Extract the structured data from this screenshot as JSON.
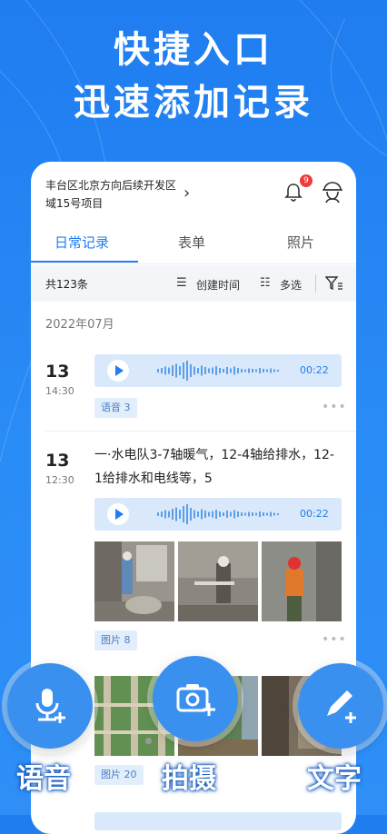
{
  "headline": {
    "line1": "快捷入口",
    "line2": "迅速添加记录"
  },
  "header": {
    "project_name": "丰台区北京方向后续开发区域15号项目",
    "notification_count": "9"
  },
  "tabs": [
    {
      "label": "日常记录",
      "active": true
    },
    {
      "label": "表单"
    },
    {
      "label": "照片"
    }
  ],
  "toolbar": {
    "count": "共123条",
    "sort_label": "创建时间",
    "multi_label": "多选"
  },
  "month": "2022年07月",
  "records": [
    {
      "day": "13",
      "time": "14:30",
      "audio_duration": "00:22",
      "tag": "语音 3"
    },
    {
      "day": "13",
      "time": "12:30",
      "text": "一·水电队3-7轴暖气，12-4轴给排水，12-1给排水和电线等，5",
      "audio_duration": "00:22",
      "tag": "图片 8"
    }
  ],
  "third_tag": "图片 20",
  "fabs": {
    "voice_label": "语音",
    "camera_label": "拍摄",
    "text_label": "文字"
  },
  "colors": {
    "accent": "#1f7df0",
    "background": "#2a8cf6"
  }
}
